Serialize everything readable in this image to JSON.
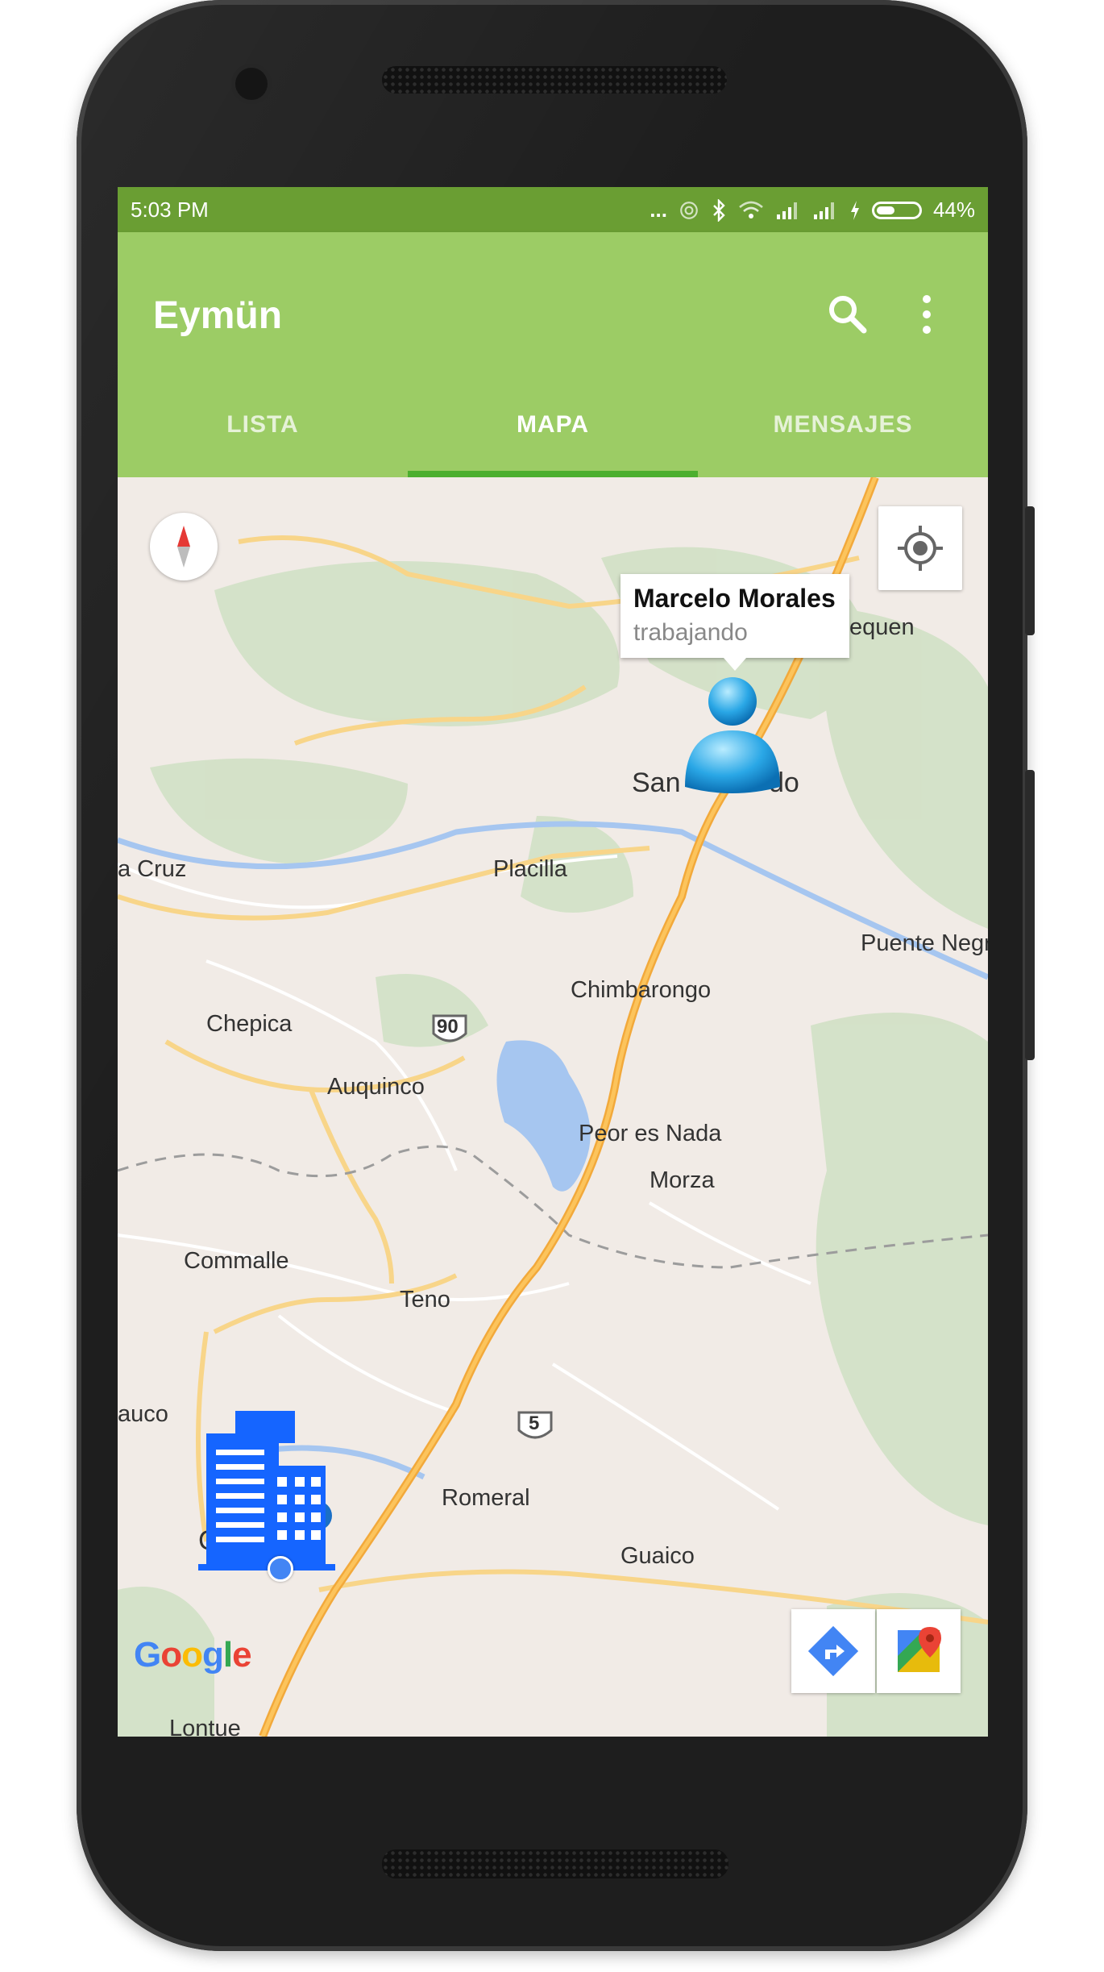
{
  "status_bar": {
    "time": "5:03 PM",
    "dots": "...",
    "battery_percent": "44%",
    "battery_level": 0.44
  },
  "app": {
    "title": "Eymün",
    "primary_color": "#9ccc65",
    "status_color": "#6a9e33",
    "accent_color": "#4caf2f"
  },
  "tabs": [
    {
      "label": "LISTA",
      "selected": false
    },
    {
      "label": "MAPA",
      "selected": true
    },
    {
      "label": "MENSAJES",
      "selected": false
    }
  ],
  "toolbar_icons": [
    "search-icon",
    "more-vert-icon"
  ],
  "map": {
    "info_window": {
      "name": "Marcelo Morales",
      "status": "trabajando"
    },
    "labels": {
      "san_fernando_left": "San",
      "san_fernando_right": "do",
      "santa_cruz": "a Cruz",
      "placilla": "Placilla",
      "chimbarongo": "Chimbarongo",
      "puente_negro": "Puente Negr",
      "chepica": "Chepica",
      "auquinco": "Auquinco",
      "peor_es_nada": "Peor es Nada",
      "morza": "Morza",
      "commalle": "Commalle",
      "teno": "Teno",
      "rauco": "auco",
      "curico": "C",
      "romeral": "Romeral",
      "guaico": "Guaico",
      "lontue": "Lontue",
      "quequen": "equen"
    },
    "route_shields": [
      "90",
      "5"
    ],
    "google_logo": "Google",
    "controls": [
      "compass-icon",
      "my-location-icon",
      "directions-icon",
      "google-maps-icon"
    ]
  }
}
